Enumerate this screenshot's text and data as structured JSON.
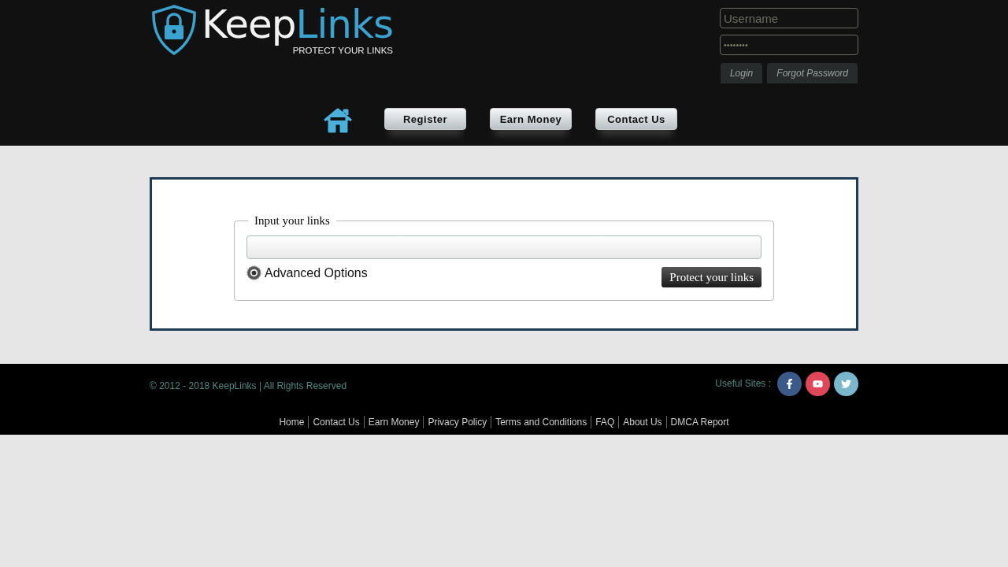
{
  "logo": {
    "name_part1": "Keep",
    "name_part2": "Links",
    "tagline": "PROTECT YOUR LINKS"
  },
  "login": {
    "username_placeholder": "Username",
    "password_value": "••••••••",
    "buttons": [
      "Login",
      "Forgot Password"
    ]
  },
  "nav": {
    "items": [
      "Register",
      "Earn Money",
      "Contact Us"
    ]
  },
  "form": {
    "legend": "Input your links",
    "advanced_options": "Advanced Options",
    "submit": "Protect your links"
  },
  "footer": {
    "copyright": "© 2012 - 2018 KeepLinks | All Rights Reserved",
    "useful_sites_label": "Useful Sites :",
    "social": [
      {
        "kind": "facebook",
        "color": "#3b5a8a"
      },
      {
        "kind": "youtube",
        "color": "#e0485a"
      },
      {
        "kind": "twitter",
        "color": "#7ab6cc"
      }
    ],
    "links": [
      "Home",
      "Contact Us",
      "Earn Money",
      "Privacy Policy",
      "Terms and Conditions",
      "FAQ",
      "About Us",
      "DMCA Report"
    ]
  }
}
